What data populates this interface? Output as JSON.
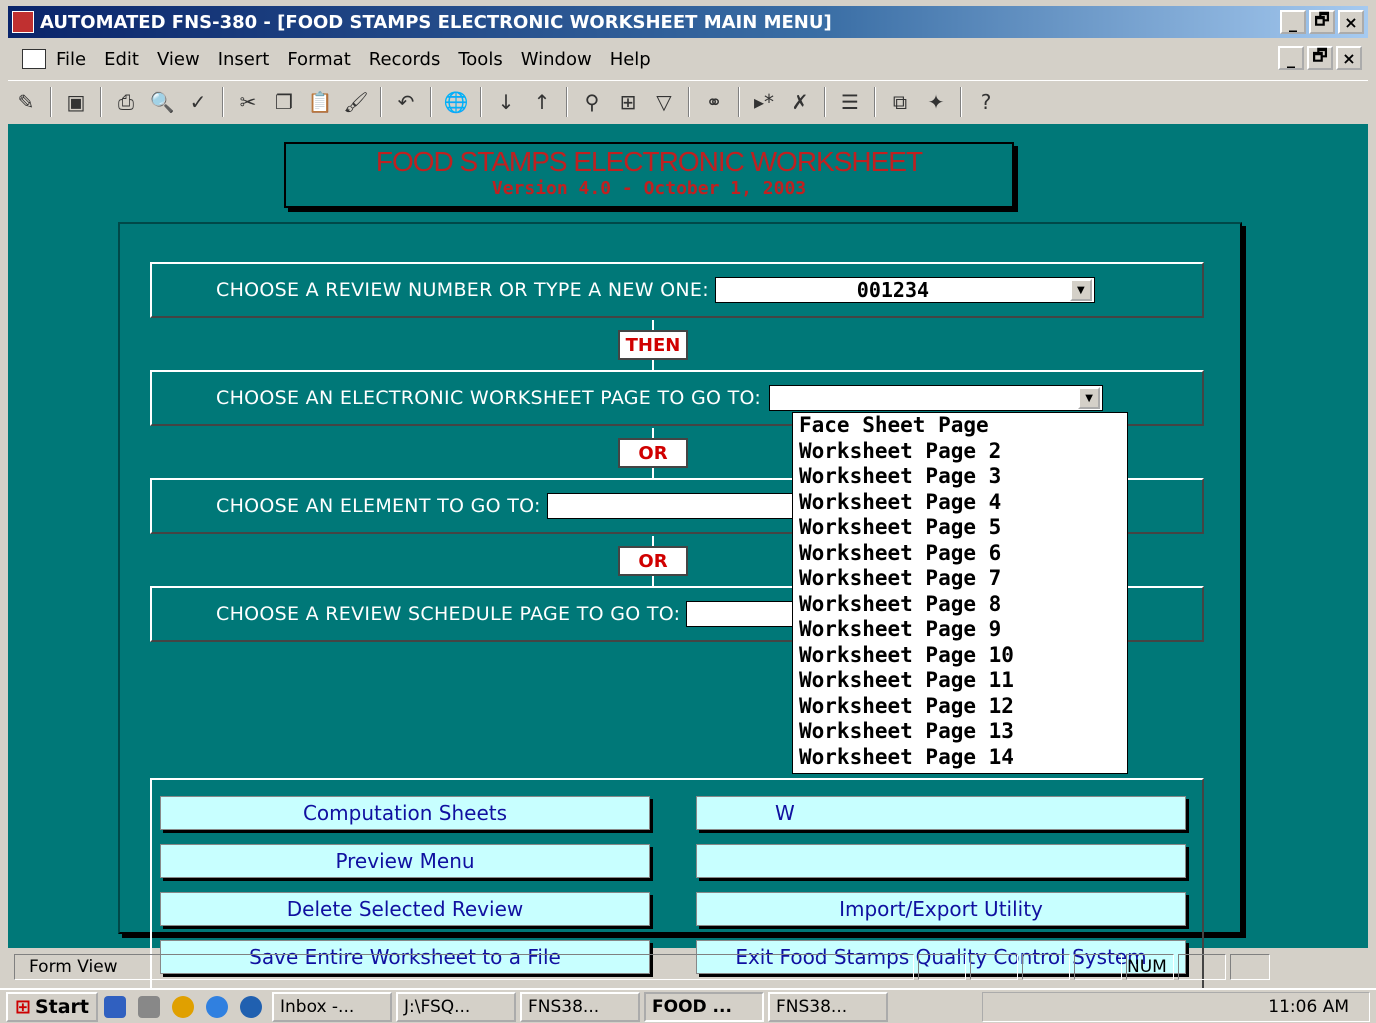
{
  "window": {
    "title": "AUTOMATED FNS-380 - [FOOD STAMPS  ELECTRONIC WORKSHEET MAIN MENU]",
    "min": "_",
    "max": "🗗",
    "close": "×"
  },
  "menu": [
    "File",
    "Edit",
    "View",
    "Insert",
    "Format",
    "Records",
    "Tools",
    "Window",
    "Help"
  ],
  "header": {
    "title": "FOOD STAMPS ELECTRONIC WORKSHEET",
    "version": "Version 4.0  -  October 1, 2003"
  },
  "rows": {
    "review_label": "CHOOSE A REVIEW NUMBER OR TYPE A NEW ONE:",
    "review_value": "001234",
    "then": "THEN",
    "page_label": "CHOOSE AN ELECTRONIC WORKSHEET PAGE TO GO TO:",
    "or1": "OR",
    "element_label": "CHOOSE AN ELEMENT TO GO TO:",
    "or2": "OR",
    "schedule_label": "CHOOSE A REVIEW SCHEDULE PAGE TO GO TO:"
  },
  "dropdown_options": [
    "Face Sheet Page",
    "Worksheet Page 2",
    "Worksheet Page 3",
    "Worksheet Page 4",
    "Worksheet Page 5",
    "Worksheet Page 6",
    "Worksheet Page 7",
    "Worksheet Page 8",
    "Worksheet Page 9",
    "Worksheet Page 10",
    "Worksheet Page 11",
    "Worksheet Page 12",
    "Worksheet Page 13",
    "Worksheet Page 14"
  ],
  "buttons": {
    "computation": "Computation Sheets",
    "preview": "Preview Menu",
    "delete": "Delete Selected Review",
    "save": "Save Entire Worksheet to a File",
    "right1": "W",
    "right2": "",
    "import": "Import/Export Utility",
    "exit": "Exit Food Stamps Quality Control System"
  },
  "status": {
    "mode": "Form View",
    "num": "NUM"
  },
  "taskbar": {
    "start": "Start",
    "tasks": [
      "Inbox -...",
      "J:\\FSQ...",
      "FNS38...",
      "FOOD ...",
      "FNS38..."
    ],
    "clock": "11:06 AM"
  }
}
